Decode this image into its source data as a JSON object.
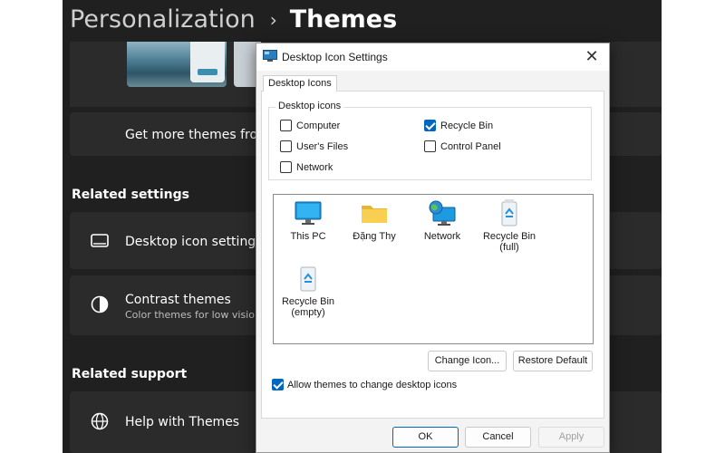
{
  "settings": {
    "breadcrumb": {
      "parent": "Personalization",
      "current": "Themes",
      "separator": "›"
    },
    "get_more_themes": "Get more themes from",
    "related_settings": {
      "heading": "Related settings",
      "desktop_icon_settings": "Desktop icon settings",
      "contrast_themes": "Contrast themes",
      "contrast_themes_sub": "Color themes for low vision"
    },
    "related_support": {
      "heading": "Related support",
      "help_with_themes": "Help with Themes"
    }
  },
  "dialog": {
    "title": "Desktop Icon Settings",
    "tab": "Desktop Icons",
    "group_title": "Desktop icons",
    "checkboxes": [
      {
        "label": "Computer",
        "checked": false
      },
      {
        "label": "Recycle Bin",
        "checked": true
      },
      {
        "label": "User's Files",
        "checked": false
      },
      {
        "label": "Control Panel",
        "checked": false
      },
      {
        "label": "Network",
        "checked": false
      }
    ],
    "icons": [
      {
        "label": "This PC",
        "icon": "monitor-icon"
      },
      {
        "label": "Đặng Thy",
        "icon": "folder-icon"
      },
      {
        "label": "Network",
        "icon": "network-globe-icon"
      },
      {
        "label": "Recycle Bin\n(full)",
        "icon": "recycle-bin-full-icon"
      },
      {
        "label": "Recycle Bin\n(empty)",
        "icon": "recycle-bin-empty-icon"
      }
    ],
    "change_icon": "Change Icon...",
    "restore_default": "Restore Default",
    "allow_themes": {
      "label": "Allow themes to change desktop icons",
      "checked": true
    },
    "ok": "OK",
    "cancel": "Cancel",
    "apply": "Apply",
    "close_glyph": "✕"
  }
}
